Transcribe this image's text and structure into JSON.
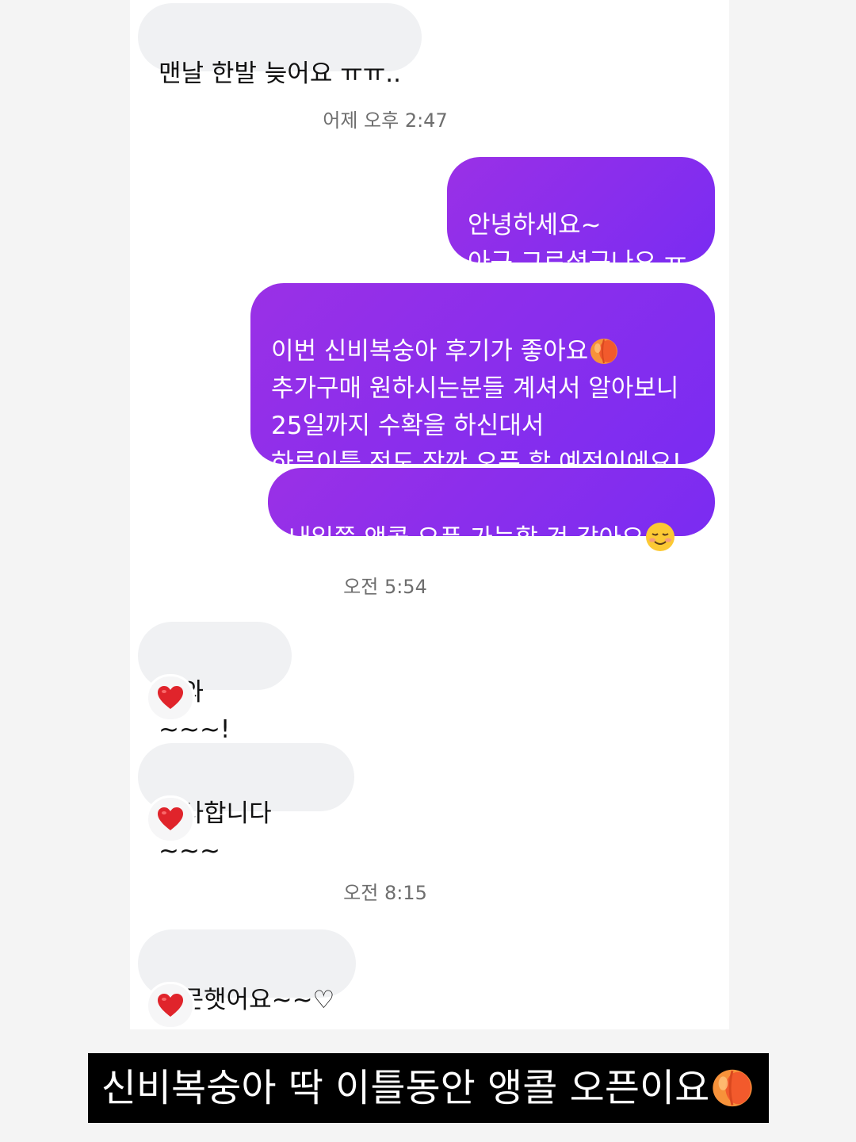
{
  "messages": {
    "m1": "맨날  한발  늦어요 ㅠㅠ..",
    "t1": "어제 오후 2:47",
    "m2": "안녕하세요~\n아구 그르셨구나요 ㅠ",
    "m3_line1": "이번 신비복숭아 후기가 좋아요",
    "m3_rest": "추가구매 원하시는분들 계셔서 알아보니\n25일까지 수확을 하신대서\n하루이틀 정도 잠깐 오픈 할 예정이에요!",
    "m4": "내일쯤 앵콜 오픈 가능할 것 같아요",
    "t2": "오전 5:54",
    "m5": "우와 ~~~!",
    "m6": "감사합니다 ~~~",
    "t3": "오전 8:15",
    "m7": "주문햇어요~~♡"
  },
  "caption": "신비복숭아 딱 이틀동안 앵콜 오픈이요",
  "icons": {
    "peach": "peach-emoji-icon",
    "smile": "smiling-face-emoji-icon",
    "reaction": "red-heart-icon"
  },
  "colors": {
    "outgoing_bubble": "#8a2ee8",
    "incoming_bubble": "#f0f1f3",
    "reaction_heart": "#e0242b"
  }
}
